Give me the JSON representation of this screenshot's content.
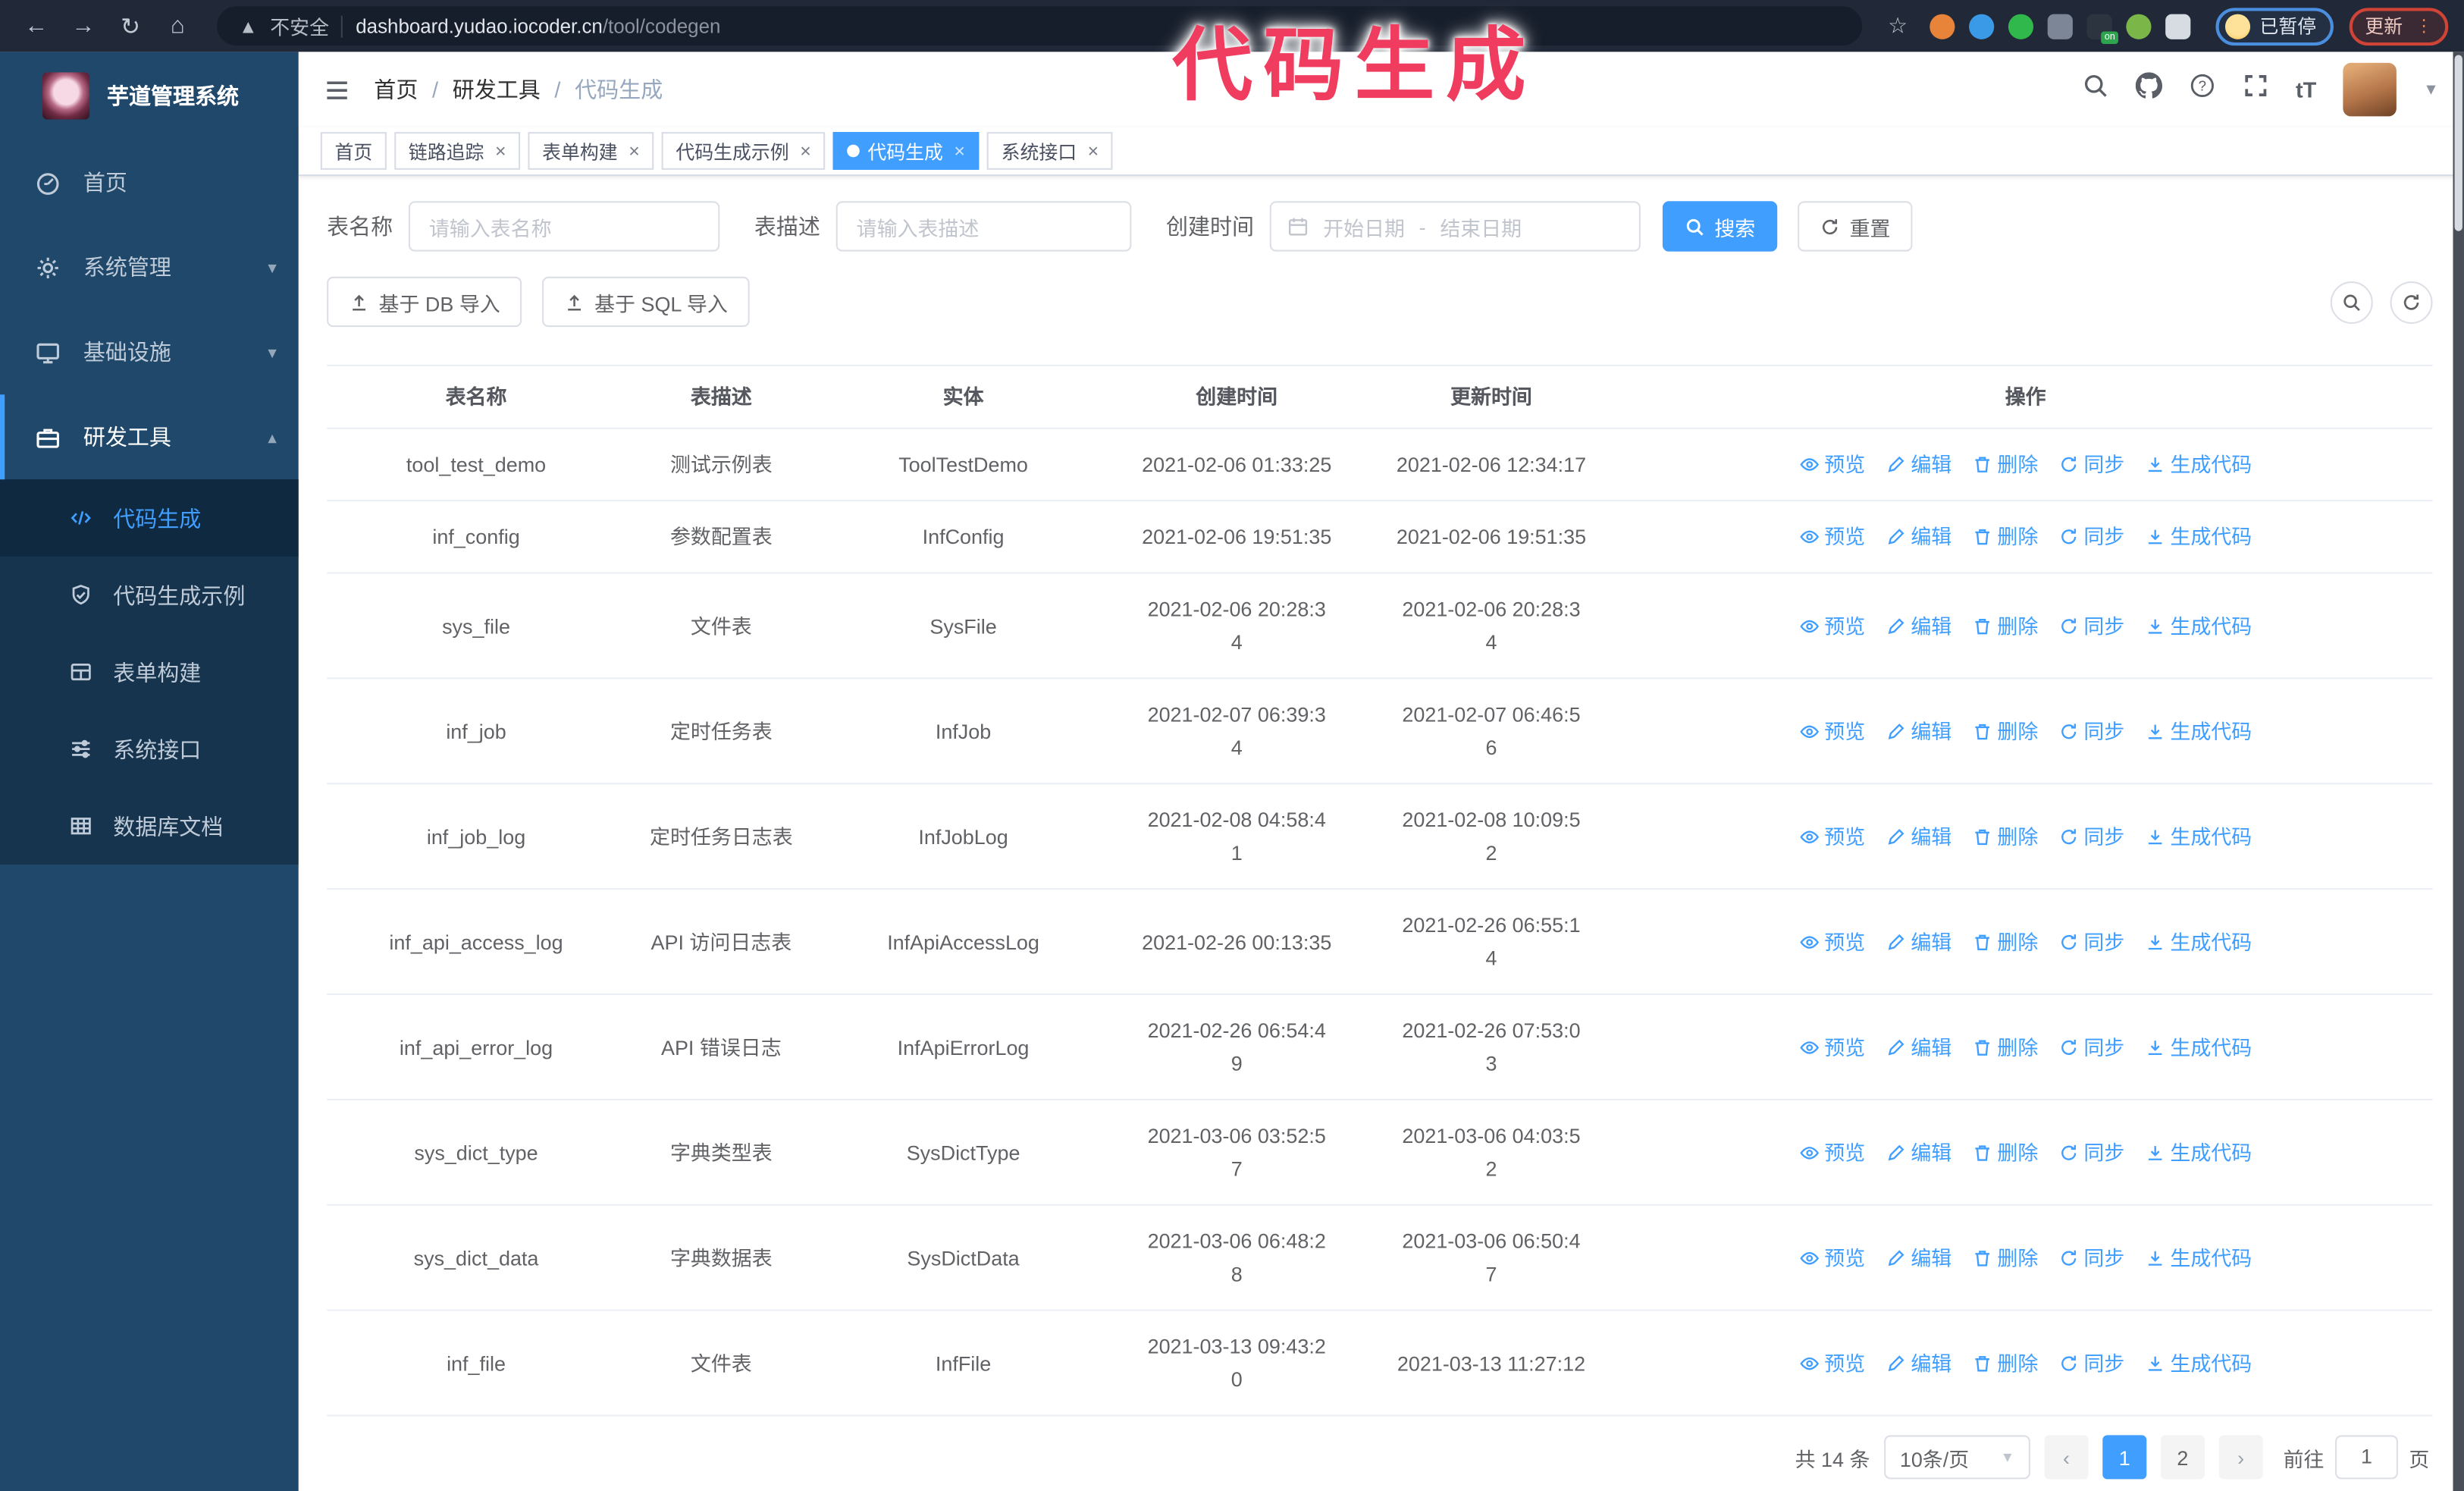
{
  "watermark": "代码生成",
  "browser": {
    "security_label": "不安全",
    "url_domain": "dashboard.yudao.iocoder.cn",
    "url_path": "/tool/codegen",
    "profile_badge": "已暂停",
    "update_button": "更新",
    "extensions": [
      {
        "icon": "orange-extension-icon",
        "color": "#e8833a",
        "shape": "round",
        "badge": ""
      },
      {
        "icon": "blue-gem-extension-icon",
        "color": "#3b9ae8",
        "shape": "round",
        "badge": ""
      },
      {
        "icon": "green-check-extension-icon",
        "color": "#30b84c",
        "shape": "round",
        "badge": ""
      },
      {
        "icon": "grid-extension-icon",
        "color": "#7c8697",
        "shape": "square",
        "badge": ""
      },
      {
        "icon": "dark-extension-icon",
        "color": "#2c3440",
        "shape": "square",
        "badge": "on"
      },
      {
        "icon": "green-person-extension-icon",
        "color": "#7ab648",
        "shape": "round",
        "badge": ""
      },
      {
        "icon": "puzzle-extension-icon",
        "color": "#d7dbe2",
        "shape": "square",
        "badge": ""
      }
    ]
  },
  "sidebar": {
    "app_title": "芋道管理系统",
    "menu": [
      {
        "label": "首页",
        "icon": "dashboard-icon",
        "expandable": false,
        "expanded": false
      },
      {
        "label": "系统管理",
        "icon": "gear-icon",
        "expandable": true,
        "expanded": false
      },
      {
        "label": "基础设施",
        "icon": "monitor-icon",
        "expandable": true,
        "expanded": false
      },
      {
        "label": "研发工具",
        "icon": "briefcase-icon",
        "expandable": true,
        "expanded": true
      }
    ],
    "submenu": [
      {
        "label": "代码生成",
        "icon": "code-icon",
        "active": true
      },
      {
        "label": "代码生成示例",
        "icon": "shield-check-icon",
        "active": false
      },
      {
        "label": "表单构建",
        "icon": "form-icon",
        "active": false
      },
      {
        "label": "系统接口",
        "icon": "sliders-icon",
        "active": false
      },
      {
        "label": "数据库文档",
        "icon": "db-table-icon",
        "active": false
      }
    ]
  },
  "breadcrumb": [
    "首页",
    "研发工具",
    "代码生成"
  ],
  "tabs": [
    {
      "label": "首页",
      "closable": false,
      "active": false
    },
    {
      "label": "链路追踪",
      "closable": true,
      "active": false
    },
    {
      "label": "表单构建",
      "closable": true,
      "active": false
    },
    {
      "label": "代码生成示例",
      "closable": true,
      "active": false
    },
    {
      "label": "代码生成",
      "closable": true,
      "active": true
    },
    {
      "label": "系统接口",
      "closable": true,
      "active": false
    }
  ],
  "filters": {
    "table_name_label": "表名称",
    "table_name_placeholder": "请输入表名称",
    "table_desc_label": "表描述",
    "table_desc_placeholder": "请输入表描述",
    "create_time_label": "创建时间",
    "date_start_placeholder": "开始日期",
    "date_separator": "-",
    "date_end_placeholder": "结束日期",
    "search_button": "搜索",
    "reset_button": "重置"
  },
  "toolbar": {
    "import_db": "基于 DB 导入",
    "import_sql": "基于 SQL 导入"
  },
  "table": {
    "columns": [
      "表名称",
      "表描述",
      "实体",
      "创建时间",
      "更新时间",
      "操作"
    ],
    "actions": [
      "预览",
      "编辑",
      "删除",
      "同步",
      "生成代码"
    ],
    "action_icons": [
      "eye-icon",
      "edit-icon",
      "delete-icon",
      "sync-icon",
      "download-icon"
    ],
    "rows": [
      {
        "name": "tool_test_demo",
        "desc": "测试示例表",
        "entity": "ToolTestDemo",
        "created": "2021-02-06 01:33:25",
        "updated": "2021-02-06 12:34:17"
      },
      {
        "name": "inf_config",
        "desc": "参数配置表",
        "entity": "InfConfig",
        "created": "2021-02-06 19:51:35",
        "updated": "2021-02-06 19:51:35"
      },
      {
        "name": "sys_file",
        "desc": "文件表",
        "entity": "SysFile",
        "created": "2021-02-06 20:28:3\n4",
        "updated": "2021-02-06 20:28:3\n4"
      },
      {
        "name": "inf_job",
        "desc": "定时任务表",
        "entity": "InfJob",
        "created": "2021-02-07 06:39:3\n4",
        "updated": "2021-02-07 06:46:5\n6"
      },
      {
        "name": "inf_job_log",
        "desc": "定时任务日志表",
        "entity": "InfJobLog",
        "created": "2021-02-08 04:58:4\n1",
        "updated": "2021-02-08 10:09:5\n2"
      },
      {
        "name": "inf_api_access_log",
        "desc": "API 访问日志表",
        "entity": "InfApiAccessLog",
        "created": "2021-02-26 00:13:35",
        "updated": "2021-02-26 06:55:1\n4"
      },
      {
        "name": "inf_api_error_log",
        "desc": "API 错误日志",
        "entity": "InfApiErrorLog",
        "created": "2021-02-26 06:54:4\n9",
        "updated": "2021-02-26 07:53:0\n3"
      },
      {
        "name": "sys_dict_type",
        "desc": "字典类型表",
        "entity": "SysDictType",
        "created": "2021-03-06 03:52:5\n7",
        "updated": "2021-03-06 04:03:5\n2"
      },
      {
        "name": "sys_dict_data",
        "desc": "字典数据表",
        "entity": "SysDictData",
        "created": "2021-03-06 06:48:2\n8",
        "updated": "2021-03-06 06:50:4\n7"
      },
      {
        "name": "inf_file",
        "desc": "文件表",
        "entity": "InfFile",
        "created": "2021-03-13 09:43:2\n0",
        "updated": "2021-03-13 11:27:12"
      }
    ]
  },
  "pagination": {
    "total": "共 14 条",
    "page_size": "10条/页",
    "pages": [
      "1",
      "2"
    ],
    "active_page": "1",
    "goto_label": "前往",
    "goto_value": "1",
    "page_label": "页"
  }
}
